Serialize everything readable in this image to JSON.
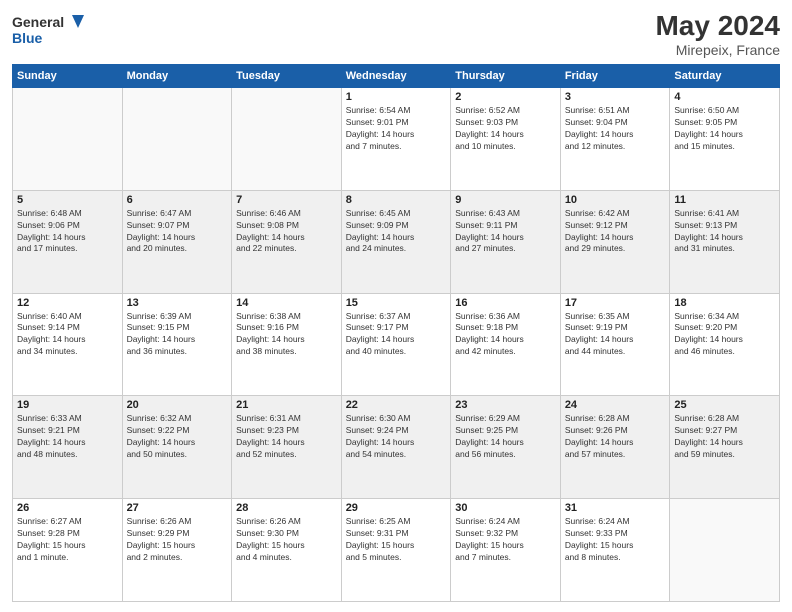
{
  "header": {
    "logo_general": "General",
    "logo_blue": "Blue",
    "title": "May 2024",
    "location": "Mirepeix, France"
  },
  "days_of_week": [
    "Sunday",
    "Monday",
    "Tuesday",
    "Wednesday",
    "Thursday",
    "Friday",
    "Saturday"
  ],
  "weeks": [
    {
      "shaded": false,
      "days": [
        {
          "num": "",
          "info": "",
          "empty": true
        },
        {
          "num": "",
          "info": "",
          "empty": true
        },
        {
          "num": "",
          "info": "",
          "empty": true
        },
        {
          "num": "1",
          "info": "Sunrise: 6:54 AM\nSunset: 9:01 PM\nDaylight: 14 hours\nand 7 minutes."
        },
        {
          "num": "2",
          "info": "Sunrise: 6:52 AM\nSunset: 9:03 PM\nDaylight: 14 hours\nand 10 minutes."
        },
        {
          "num": "3",
          "info": "Sunrise: 6:51 AM\nSunset: 9:04 PM\nDaylight: 14 hours\nand 12 minutes."
        },
        {
          "num": "4",
          "info": "Sunrise: 6:50 AM\nSunset: 9:05 PM\nDaylight: 14 hours\nand 15 minutes."
        }
      ]
    },
    {
      "shaded": true,
      "days": [
        {
          "num": "5",
          "info": "Sunrise: 6:48 AM\nSunset: 9:06 PM\nDaylight: 14 hours\nand 17 minutes."
        },
        {
          "num": "6",
          "info": "Sunrise: 6:47 AM\nSunset: 9:07 PM\nDaylight: 14 hours\nand 20 minutes."
        },
        {
          "num": "7",
          "info": "Sunrise: 6:46 AM\nSunset: 9:08 PM\nDaylight: 14 hours\nand 22 minutes."
        },
        {
          "num": "8",
          "info": "Sunrise: 6:45 AM\nSunset: 9:09 PM\nDaylight: 14 hours\nand 24 minutes."
        },
        {
          "num": "9",
          "info": "Sunrise: 6:43 AM\nSunset: 9:11 PM\nDaylight: 14 hours\nand 27 minutes."
        },
        {
          "num": "10",
          "info": "Sunrise: 6:42 AM\nSunset: 9:12 PM\nDaylight: 14 hours\nand 29 minutes."
        },
        {
          "num": "11",
          "info": "Sunrise: 6:41 AM\nSunset: 9:13 PM\nDaylight: 14 hours\nand 31 minutes."
        }
      ]
    },
    {
      "shaded": false,
      "days": [
        {
          "num": "12",
          "info": "Sunrise: 6:40 AM\nSunset: 9:14 PM\nDaylight: 14 hours\nand 34 minutes."
        },
        {
          "num": "13",
          "info": "Sunrise: 6:39 AM\nSunset: 9:15 PM\nDaylight: 14 hours\nand 36 minutes."
        },
        {
          "num": "14",
          "info": "Sunrise: 6:38 AM\nSunset: 9:16 PM\nDaylight: 14 hours\nand 38 minutes."
        },
        {
          "num": "15",
          "info": "Sunrise: 6:37 AM\nSunset: 9:17 PM\nDaylight: 14 hours\nand 40 minutes."
        },
        {
          "num": "16",
          "info": "Sunrise: 6:36 AM\nSunset: 9:18 PM\nDaylight: 14 hours\nand 42 minutes."
        },
        {
          "num": "17",
          "info": "Sunrise: 6:35 AM\nSunset: 9:19 PM\nDaylight: 14 hours\nand 44 minutes."
        },
        {
          "num": "18",
          "info": "Sunrise: 6:34 AM\nSunset: 9:20 PM\nDaylight: 14 hours\nand 46 minutes."
        }
      ]
    },
    {
      "shaded": true,
      "days": [
        {
          "num": "19",
          "info": "Sunrise: 6:33 AM\nSunset: 9:21 PM\nDaylight: 14 hours\nand 48 minutes."
        },
        {
          "num": "20",
          "info": "Sunrise: 6:32 AM\nSunset: 9:22 PM\nDaylight: 14 hours\nand 50 minutes."
        },
        {
          "num": "21",
          "info": "Sunrise: 6:31 AM\nSunset: 9:23 PM\nDaylight: 14 hours\nand 52 minutes."
        },
        {
          "num": "22",
          "info": "Sunrise: 6:30 AM\nSunset: 9:24 PM\nDaylight: 14 hours\nand 54 minutes."
        },
        {
          "num": "23",
          "info": "Sunrise: 6:29 AM\nSunset: 9:25 PM\nDaylight: 14 hours\nand 56 minutes."
        },
        {
          "num": "24",
          "info": "Sunrise: 6:28 AM\nSunset: 9:26 PM\nDaylight: 14 hours\nand 57 minutes."
        },
        {
          "num": "25",
          "info": "Sunrise: 6:28 AM\nSunset: 9:27 PM\nDaylight: 14 hours\nand 59 minutes."
        }
      ]
    },
    {
      "shaded": false,
      "days": [
        {
          "num": "26",
          "info": "Sunrise: 6:27 AM\nSunset: 9:28 PM\nDaylight: 15 hours\nand 1 minute."
        },
        {
          "num": "27",
          "info": "Sunrise: 6:26 AM\nSunset: 9:29 PM\nDaylight: 15 hours\nand 2 minutes."
        },
        {
          "num": "28",
          "info": "Sunrise: 6:26 AM\nSunset: 9:30 PM\nDaylight: 15 hours\nand 4 minutes."
        },
        {
          "num": "29",
          "info": "Sunrise: 6:25 AM\nSunset: 9:31 PM\nDaylight: 15 hours\nand 5 minutes."
        },
        {
          "num": "30",
          "info": "Sunrise: 6:24 AM\nSunset: 9:32 PM\nDaylight: 15 hours\nand 7 minutes."
        },
        {
          "num": "31",
          "info": "Sunrise: 6:24 AM\nSunset: 9:33 PM\nDaylight: 15 hours\nand 8 minutes."
        },
        {
          "num": "",
          "info": "",
          "empty": true
        }
      ]
    }
  ]
}
